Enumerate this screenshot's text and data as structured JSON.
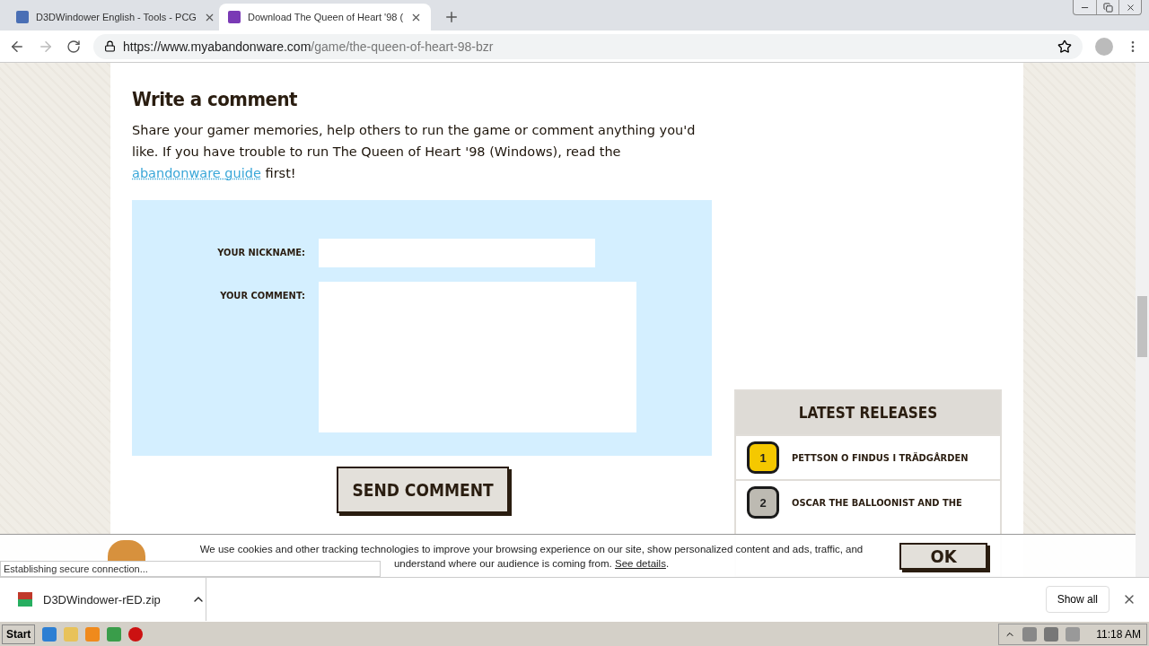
{
  "browser": {
    "tabs": [
      {
        "title": "D3DWindower English - Tools - PCG",
        "selected": false
      },
      {
        "title": "Download The Queen of Heart '98 (",
        "selected": true
      }
    ],
    "url": {
      "host": "https://www.myabandonware.com",
      "path": "/game/the-queen-of-heart-98-bzr"
    }
  },
  "comment_section": {
    "heading": "Write a comment",
    "intro": "Share your gamer memories, help others to run the game or comment anything you'd like. If you have trouble to run The Queen of Heart '98 (Windows), read the",
    "link": "abandonware guide",
    "intro_end": "first!",
    "fields": [
      {
        "label": "YOUR NICKNAME:",
        "kind": "input"
      },
      {
        "label": "YOUR COMMENT:",
        "kind": "textarea"
      }
    ],
    "submit": "SEND COMMENT"
  },
  "latest_releases": {
    "title": "LATEST RELEASES",
    "items": [
      {
        "rank": "1",
        "title": "PETTSON O FINDUS I TRÄDGÅRDEN",
        "color": "#f5c800"
      },
      {
        "rank": "2",
        "title": "OSCAR THE BALLOONIST AND THE",
        "color": "#bdbab2"
      }
    ]
  },
  "cookie_banner": {
    "text_1": "We use cookies and other tracking technologies to improve your browsing experience on our site, show personalized content and ads,",
    "text_2": "traffic, and understand where our audience is coming from.",
    "link": "See details",
    "text_end": ".",
    "button": "OK"
  },
  "status": "Establishing secure connection...",
  "download_bar": {
    "file": "D3DWindower-rED.zip",
    "show_all": "Show all"
  },
  "taskbar": {
    "start": "Start",
    "clock": "11:18 AM"
  }
}
